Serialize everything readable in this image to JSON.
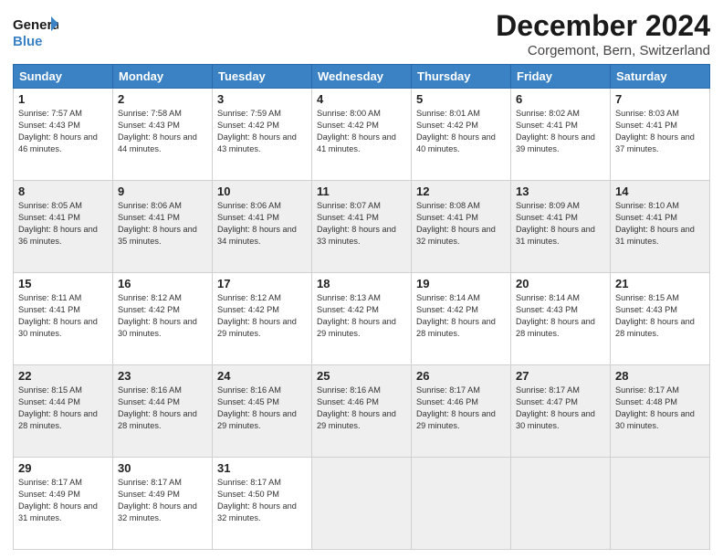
{
  "header": {
    "logo_general": "General",
    "logo_blue": "Blue",
    "title": "December 2024",
    "subtitle": "Corgemont, Bern, Switzerland"
  },
  "calendar": {
    "days_of_week": [
      "Sunday",
      "Monday",
      "Tuesday",
      "Wednesday",
      "Thursday",
      "Friday",
      "Saturday"
    ],
    "rows": [
      [
        {
          "day": "1",
          "sunrise": "Sunrise: 7:57 AM",
          "sunset": "Sunset: 4:43 PM",
          "daylight": "Daylight: 8 hours and 46 minutes."
        },
        {
          "day": "2",
          "sunrise": "Sunrise: 7:58 AM",
          "sunset": "Sunset: 4:43 PM",
          "daylight": "Daylight: 8 hours and 44 minutes."
        },
        {
          "day": "3",
          "sunrise": "Sunrise: 7:59 AM",
          "sunset": "Sunset: 4:42 PM",
          "daylight": "Daylight: 8 hours and 43 minutes."
        },
        {
          "day": "4",
          "sunrise": "Sunrise: 8:00 AM",
          "sunset": "Sunset: 4:42 PM",
          "daylight": "Daylight: 8 hours and 41 minutes."
        },
        {
          "day": "5",
          "sunrise": "Sunrise: 8:01 AM",
          "sunset": "Sunset: 4:42 PM",
          "daylight": "Daylight: 8 hours and 40 minutes."
        },
        {
          "day": "6",
          "sunrise": "Sunrise: 8:02 AM",
          "sunset": "Sunset: 4:41 PM",
          "daylight": "Daylight: 8 hours and 39 minutes."
        },
        {
          "day": "7",
          "sunrise": "Sunrise: 8:03 AM",
          "sunset": "Sunset: 4:41 PM",
          "daylight": "Daylight: 8 hours and 37 minutes."
        }
      ],
      [
        {
          "day": "8",
          "sunrise": "Sunrise: 8:05 AM",
          "sunset": "Sunset: 4:41 PM",
          "daylight": "Daylight: 8 hours and 36 minutes."
        },
        {
          "day": "9",
          "sunrise": "Sunrise: 8:06 AM",
          "sunset": "Sunset: 4:41 PM",
          "daylight": "Daylight: 8 hours and 35 minutes."
        },
        {
          "day": "10",
          "sunrise": "Sunrise: 8:06 AM",
          "sunset": "Sunset: 4:41 PM",
          "daylight": "Daylight: 8 hours and 34 minutes."
        },
        {
          "day": "11",
          "sunrise": "Sunrise: 8:07 AM",
          "sunset": "Sunset: 4:41 PM",
          "daylight": "Daylight: 8 hours and 33 minutes."
        },
        {
          "day": "12",
          "sunrise": "Sunrise: 8:08 AM",
          "sunset": "Sunset: 4:41 PM",
          "daylight": "Daylight: 8 hours and 32 minutes."
        },
        {
          "day": "13",
          "sunrise": "Sunrise: 8:09 AM",
          "sunset": "Sunset: 4:41 PM",
          "daylight": "Daylight: 8 hours and 31 minutes."
        },
        {
          "day": "14",
          "sunrise": "Sunrise: 8:10 AM",
          "sunset": "Sunset: 4:41 PM",
          "daylight": "Daylight: 8 hours and 31 minutes."
        }
      ],
      [
        {
          "day": "15",
          "sunrise": "Sunrise: 8:11 AM",
          "sunset": "Sunset: 4:41 PM",
          "daylight": "Daylight: 8 hours and 30 minutes."
        },
        {
          "day": "16",
          "sunrise": "Sunrise: 8:12 AM",
          "sunset": "Sunset: 4:42 PM",
          "daylight": "Daylight: 8 hours and 30 minutes."
        },
        {
          "day": "17",
          "sunrise": "Sunrise: 8:12 AM",
          "sunset": "Sunset: 4:42 PM",
          "daylight": "Daylight: 8 hours and 29 minutes."
        },
        {
          "day": "18",
          "sunrise": "Sunrise: 8:13 AM",
          "sunset": "Sunset: 4:42 PM",
          "daylight": "Daylight: 8 hours and 29 minutes."
        },
        {
          "day": "19",
          "sunrise": "Sunrise: 8:14 AM",
          "sunset": "Sunset: 4:42 PM",
          "daylight": "Daylight: 8 hours and 28 minutes."
        },
        {
          "day": "20",
          "sunrise": "Sunrise: 8:14 AM",
          "sunset": "Sunset: 4:43 PM",
          "daylight": "Daylight: 8 hours and 28 minutes."
        },
        {
          "day": "21",
          "sunrise": "Sunrise: 8:15 AM",
          "sunset": "Sunset: 4:43 PM",
          "daylight": "Daylight: 8 hours and 28 minutes."
        }
      ],
      [
        {
          "day": "22",
          "sunrise": "Sunrise: 8:15 AM",
          "sunset": "Sunset: 4:44 PM",
          "daylight": "Daylight: 8 hours and 28 minutes."
        },
        {
          "day": "23",
          "sunrise": "Sunrise: 8:16 AM",
          "sunset": "Sunset: 4:44 PM",
          "daylight": "Daylight: 8 hours and 28 minutes."
        },
        {
          "day": "24",
          "sunrise": "Sunrise: 8:16 AM",
          "sunset": "Sunset: 4:45 PM",
          "daylight": "Daylight: 8 hours and 29 minutes."
        },
        {
          "day": "25",
          "sunrise": "Sunrise: 8:16 AM",
          "sunset": "Sunset: 4:46 PM",
          "daylight": "Daylight: 8 hours and 29 minutes."
        },
        {
          "day": "26",
          "sunrise": "Sunrise: 8:17 AM",
          "sunset": "Sunset: 4:46 PM",
          "daylight": "Daylight: 8 hours and 29 minutes."
        },
        {
          "day": "27",
          "sunrise": "Sunrise: 8:17 AM",
          "sunset": "Sunset: 4:47 PM",
          "daylight": "Daylight: 8 hours and 30 minutes."
        },
        {
          "day": "28",
          "sunrise": "Sunrise: 8:17 AM",
          "sunset": "Sunset: 4:48 PM",
          "daylight": "Daylight: 8 hours and 30 minutes."
        }
      ],
      [
        {
          "day": "29",
          "sunrise": "Sunrise: 8:17 AM",
          "sunset": "Sunset: 4:49 PM",
          "daylight": "Daylight: 8 hours and 31 minutes."
        },
        {
          "day": "30",
          "sunrise": "Sunrise: 8:17 AM",
          "sunset": "Sunset: 4:49 PM",
          "daylight": "Daylight: 8 hours and 32 minutes."
        },
        {
          "day": "31",
          "sunrise": "Sunrise: 8:17 AM",
          "sunset": "Sunset: 4:50 PM",
          "daylight": "Daylight: 8 hours and 32 minutes."
        },
        null,
        null,
        null,
        null
      ]
    ]
  }
}
